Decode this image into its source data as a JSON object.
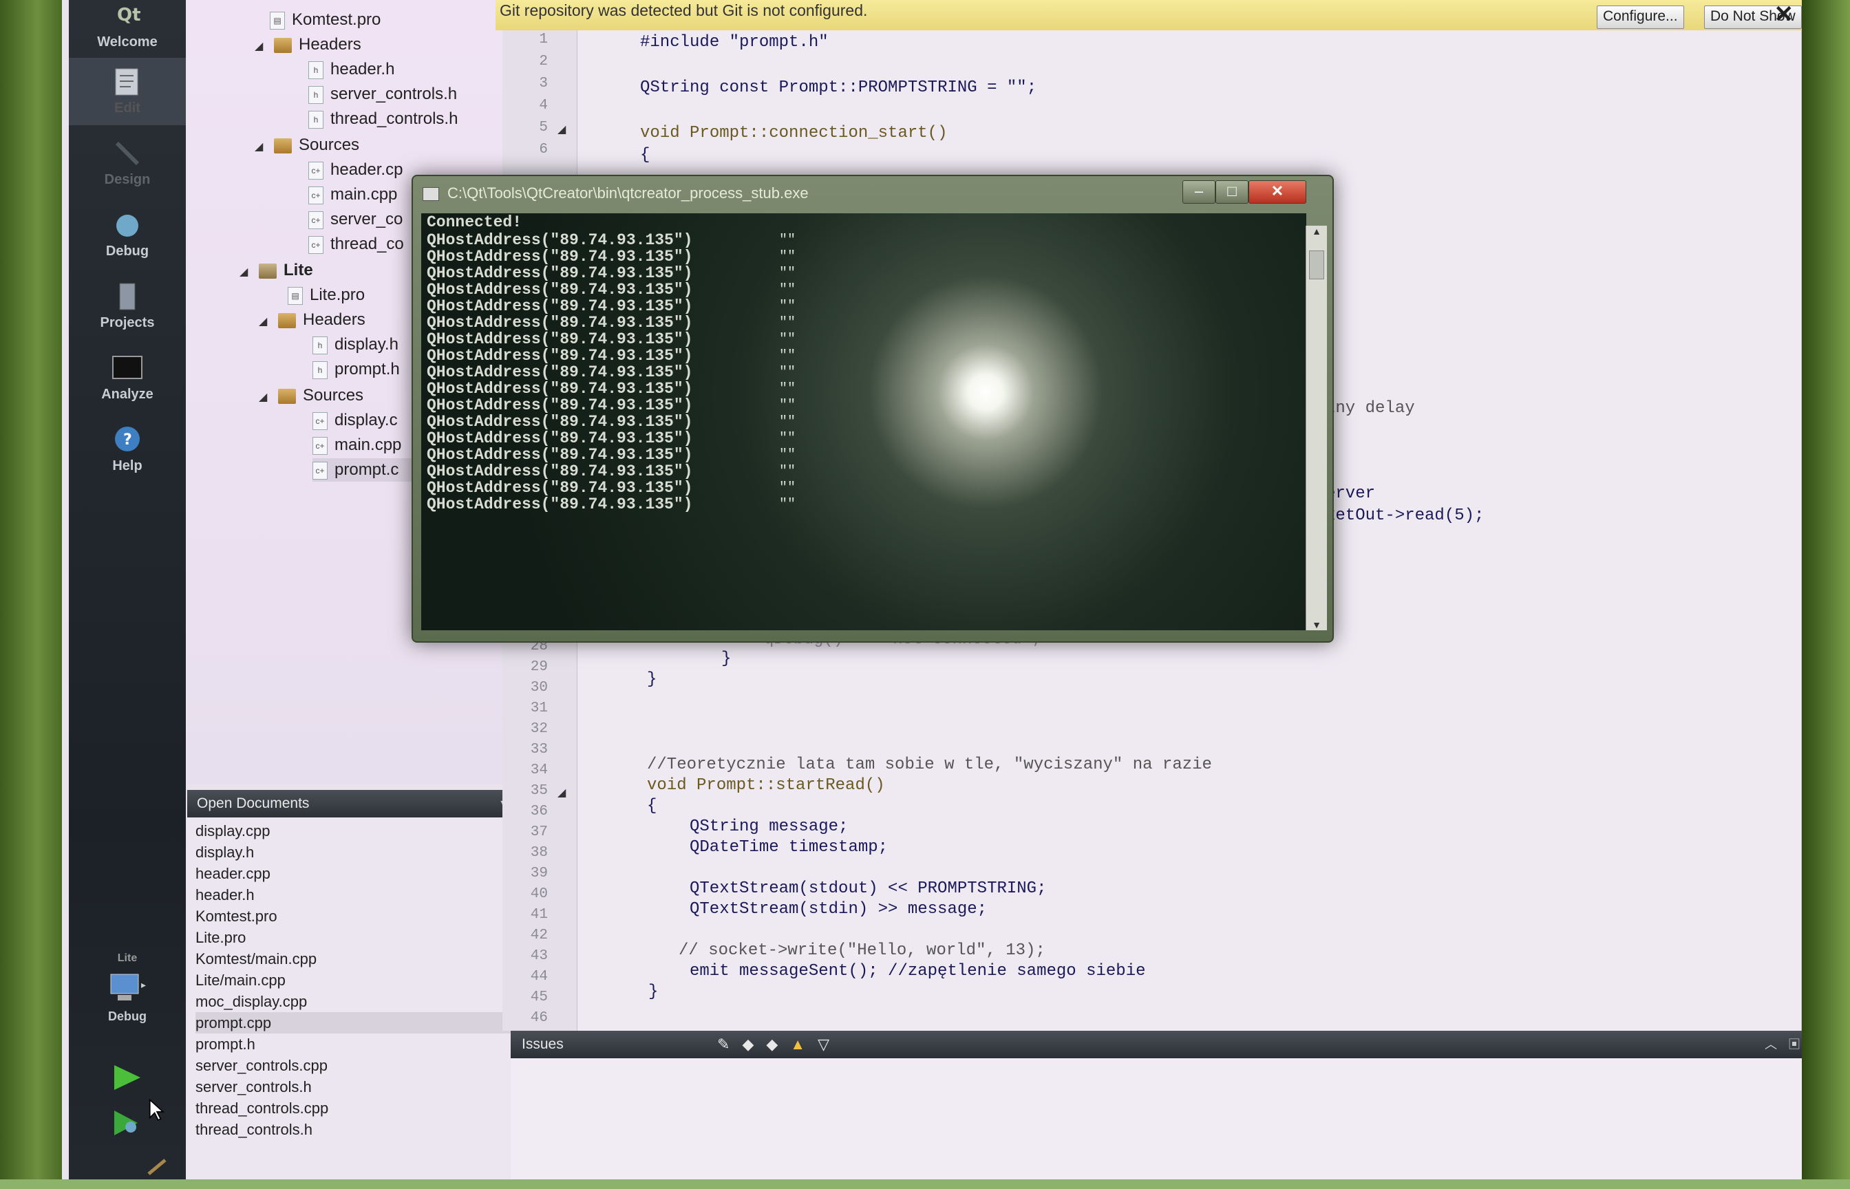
{
  "modes": [
    {
      "label": "Welcome",
      "icon": "qt-logo-icon"
    },
    {
      "label": "Edit",
      "icon": "edit-icon"
    },
    {
      "label": "Design",
      "icon": "design-icon"
    },
    {
      "label": "Debug",
      "icon": "debug-icon"
    },
    {
      "label": "Projects",
      "icon": "projects-icon"
    },
    {
      "label": "Analyze",
      "icon": "analyze-icon"
    },
    {
      "label": "Help",
      "icon": "help-icon"
    }
  ],
  "kit": {
    "project": "Lite",
    "mode": "Debug"
  },
  "tree": {
    "komtest_pro": "Komtest.pro",
    "headers1": "Headers",
    "header_h": "header.h",
    "server_controls_h": "server_controls.h",
    "thread_controls_h": "thread_controls.h",
    "sources1": "Sources",
    "header_cpp": "header.cp",
    "main_cpp1": "main.cpp",
    "server_c": "server_co",
    "thread_c": "thread_co",
    "lite": "Lite",
    "lite_pro": "Lite.pro",
    "headers2": "Headers",
    "display_h": "display.h",
    "prompt_h": "prompt.h",
    "sources2": "Sources",
    "display_c": "display.c",
    "main_cpp2": "main.cpp",
    "prompt_c": "prompt.c"
  },
  "open_documents": {
    "title": "Open Documents",
    "items": [
      "display.cpp",
      "display.h",
      "header.cpp",
      "header.h",
      "Komtest.pro",
      "Lite.pro",
      "Komtest/main.cpp",
      "Lite/main.cpp",
      "moc_display.cpp",
      "prompt.cpp",
      "prompt.h",
      "server_controls.cpp",
      "server_controls.h",
      "thread_controls.cpp",
      "thread_controls.h"
    ],
    "selected": "prompt.cpp"
  },
  "gitbar": {
    "message": "Git repository was detected but Git is not configured.",
    "configure": "Configure...",
    "dismiss": "Do Not Show Again"
  },
  "editor": {
    "lines_top": [
      "1",
      "2",
      "3",
      "4",
      "5",
      "6"
    ],
    "lines_bottom": [
      "28",
      "29",
      "30",
      "31",
      "32",
      "33",
      "34",
      "35",
      "36",
      "37",
      "38",
      "39",
      "40",
      "41",
      "42",
      "43",
      "44",
      "45",
      "46"
    ],
    "code": {
      "l1": "#include \"prompt.h\"",
      "l3": "QString const Prompt::PROMPTSTRING = \"\";",
      "l5": "void Prompt::connection_start()",
      "l6": "{",
      "r_delay": "zny delay",
      "r_server": "erver",
      "r_read": "ketOut->read(5);",
      "l28": "qDebug() << \"not connected\";",
      "l29": "}",
      "l30": "}",
      "l34": "//Teoretycznie lata tam sobie w tle, \"wyciszany\" na razie",
      "l35": "void Prompt::startRead()",
      "l36": "{",
      "l37": "QString message;",
      "l38": "QDateTime timestamp;",
      "l40": "QTextStream(stdout) << PROMPTSTRING;",
      "l41": "QTextStream(stdin) >> message;",
      "l43": "// socket->write(\"Hello, world\", 13);",
      "l44": "emit messageSent(); //zapętlenie samego siebie",
      "l45": "}"
    }
  },
  "issues": {
    "title": "Issues"
  },
  "console": {
    "title": "C:\\Qt\\Tools\\QtCreator\\bin\\qtcreator_process_stub.exe",
    "first_line": "Connected!",
    "address_line": "QHostAddress(\"89.74.93.135\")",
    "quote_mark": "\"\"",
    "repeat_count": 17
  }
}
